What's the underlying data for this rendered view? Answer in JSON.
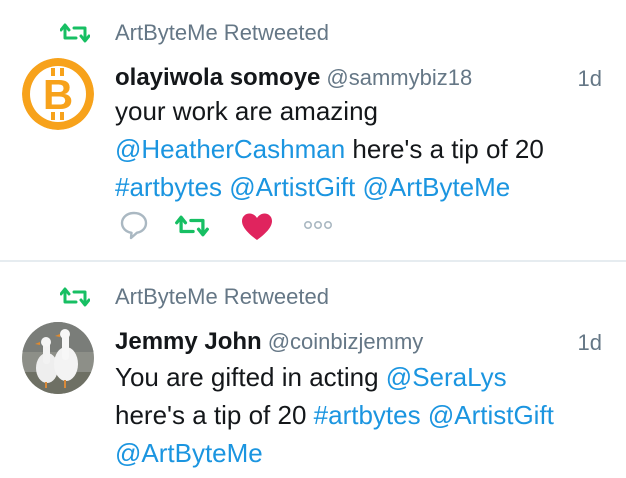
{
  "colors": {
    "accent": "#1b95e0",
    "retweet": "#17bf63",
    "like": "#e0245e",
    "muted": "#657786"
  },
  "tweets": [
    {
      "retweeted_by": "ArtByteMe Retweeted",
      "avatar_icon": "bitcoin-logo-icon",
      "name": "olayiwola somoye",
      "handle": "@sammybiz18",
      "time": "1d",
      "line1_text": "your work are amazing",
      "line2_mention": "@HeatherCashman",
      "line2_text": " here's a tip of 20",
      "line3_hashtag": "#artbytes",
      "line3_mention1": "@ArtistGift",
      "line3_mention2": "@ArtByteMe",
      "actions": [
        "reply-icon",
        "retweet-icon",
        "like-icon",
        "more-icon"
      ]
    },
    {
      "retweeted_by": "ArtByteMe Retweeted",
      "avatar_icon": "geese-photo-avatar",
      "name": "Jemmy John",
      "handle": "@coinbizjemmy",
      "time": "1d",
      "line1_text": "You are gifted in acting ",
      "line1_mention": "@SeraLys",
      "line2_text": "here's a tip of 20 ",
      "line2_hashtag": "#artbytes",
      "line2_mention": "@ArtistGift",
      "line3_mention": "@ArtByteMe"
    }
  ]
}
